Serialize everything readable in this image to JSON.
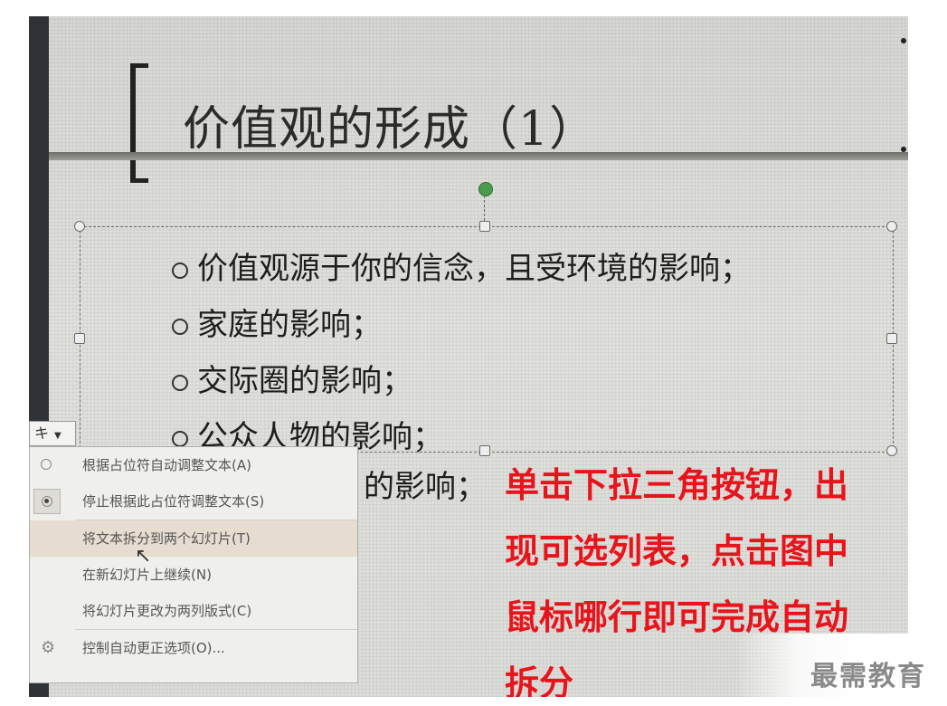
{
  "slide": {
    "title": "价值观的形成（1）",
    "bullets": [
      "价值观源于你的信念，且受环境的影响；",
      "家庭的影响；",
      "交际圈的影响；",
      "公众人物的影响；"
    ],
    "partial_bullet": "的影响；"
  },
  "autofit_button": {
    "icon_label": "キ"
  },
  "autofit_menu": {
    "items": [
      {
        "label": "根据占位符自动调整文本(A)",
        "state": "unselected"
      },
      {
        "label": "停止根据此占位符调整文本(S)",
        "state": "selected"
      },
      {
        "label": "将文本拆分到两个幻灯片(T)",
        "state": "hover"
      },
      {
        "label": "在新幻灯片上继续(N)"
      },
      {
        "label": "将幻灯片更改为两列版式(C)"
      },
      {
        "label": "控制自动更正选项(O)..."
      }
    ]
  },
  "annotation": {
    "lines": [
      "单击下拉三角按钮，出",
      "现可选列表，点击图中",
      "鼠标哪行即可完成自动",
      "拆分"
    ],
    "color": "#e8141c"
  },
  "watermark": "最需教育"
}
